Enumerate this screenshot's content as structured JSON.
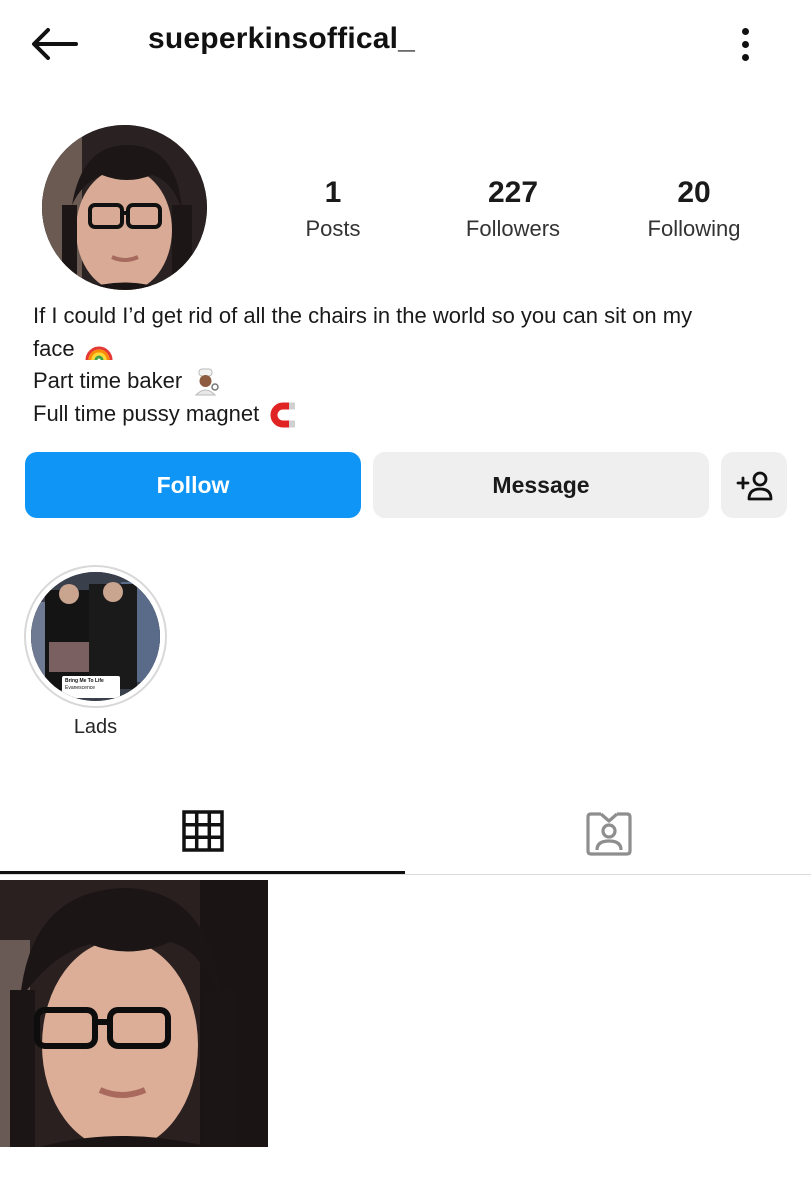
{
  "header": {
    "username": "sueperkinsoffical_",
    "back_icon": "arrow-left-icon",
    "more_icon": "more-vertical-icon"
  },
  "stats": [
    {
      "value": "1",
      "label": "Posts"
    },
    {
      "value": "227",
      "label": "Followers"
    },
    {
      "value": "20",
      "label": "Following"
    }
  ],
  "bio": {
    "line1": "If I could I’d get rid of all the chairs in the world so you can sit on my",
    "line2": "face",
    "line3": "Part time baker",
    "line4": "Full time pussy magnet",
    "emoji_line2": "rainbow-emoji",
    "emoji_line3": "baker-emoji",
    "emoji_line4": "magnet-emoji"
  },
  "actions": {
    "follow_label": "Follow",
    "message_label": "Message",
    "add_user_icon": "add-user-icon"
  },
  "highlights": [
    {
      "label": "Lads",
      "sticker_title": "Bring Me To Life",
      "sticker_artist": "Evanescence"
    }
  ],
  "tabs": [
    {
      "name": "grid",
      "icon": "grid-icon",
      "active": true
    },
    {
      "name": "tagged",
      "icon": "tagged-user-icon",
      "active": false
    }
  ],
  "colors": {
    "follow_button": "#0f95f6",
    "secondary_button": "#efefef",
    "text": "#262626"
  }
}
